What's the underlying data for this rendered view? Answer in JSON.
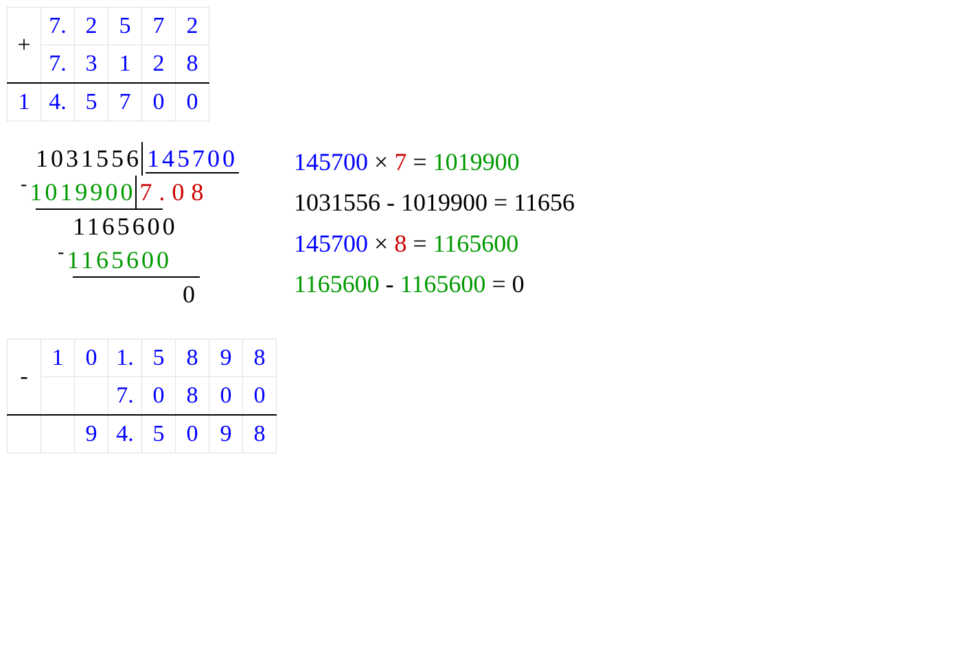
{
  "addition": {
    "op": "+",
    "row1": [
      "",
      "7.",
      "2",
      "5",
      "7",
      "2"
    ],
    "row2": [
      "",
      "7.",
      "3",
      "1",
      "2",
      "8"
    ],
    "sum": [
      "1",
      "4.",
      "5",
      "7",
      "0",
      "0"
    ]
  },
  "long_division": {
    "dividend": "1031556",
    "divisor": "145700",
    "quotient": "7.08",
    "sub1": "1019900",
    "rem1_line": "1165600",
    "sub2": "1165600",
    "final": "0"
  },
  "steps": {
    "s1a": "145700",
    "s1b": "×",
    "s1c": "7",
    "s1d": "=",
    "s1e": "1019900",
    "s2": "1031556 - 1019900 = 11656",
    "s3a": "145700",
    "s3b": "×",
    "s3c": "8",
    "s3d": "=",
    "s3e": "1165600",
    "s4a": "1165600",
    "s4b": "-",
    "s4c": "1165600",
    "s4d": "=",
    "s4e": "0"
  },
  "subtraction": {
    "op": "-",
    "row1": [
      "",
      "1",
      "0",
      "1.",
      "5",
      "8",
      "9",
      "8"
    ],
    "row2": [
      "",
      "",
      "",
      "7.",
      "0",
      "8",
      "0",
      "0"
    ],
    "diff": [
      "",
      "",
      "9",
      "4.",
      "5",
      "0",
      "9",
      "8"
    ]
  }
}
